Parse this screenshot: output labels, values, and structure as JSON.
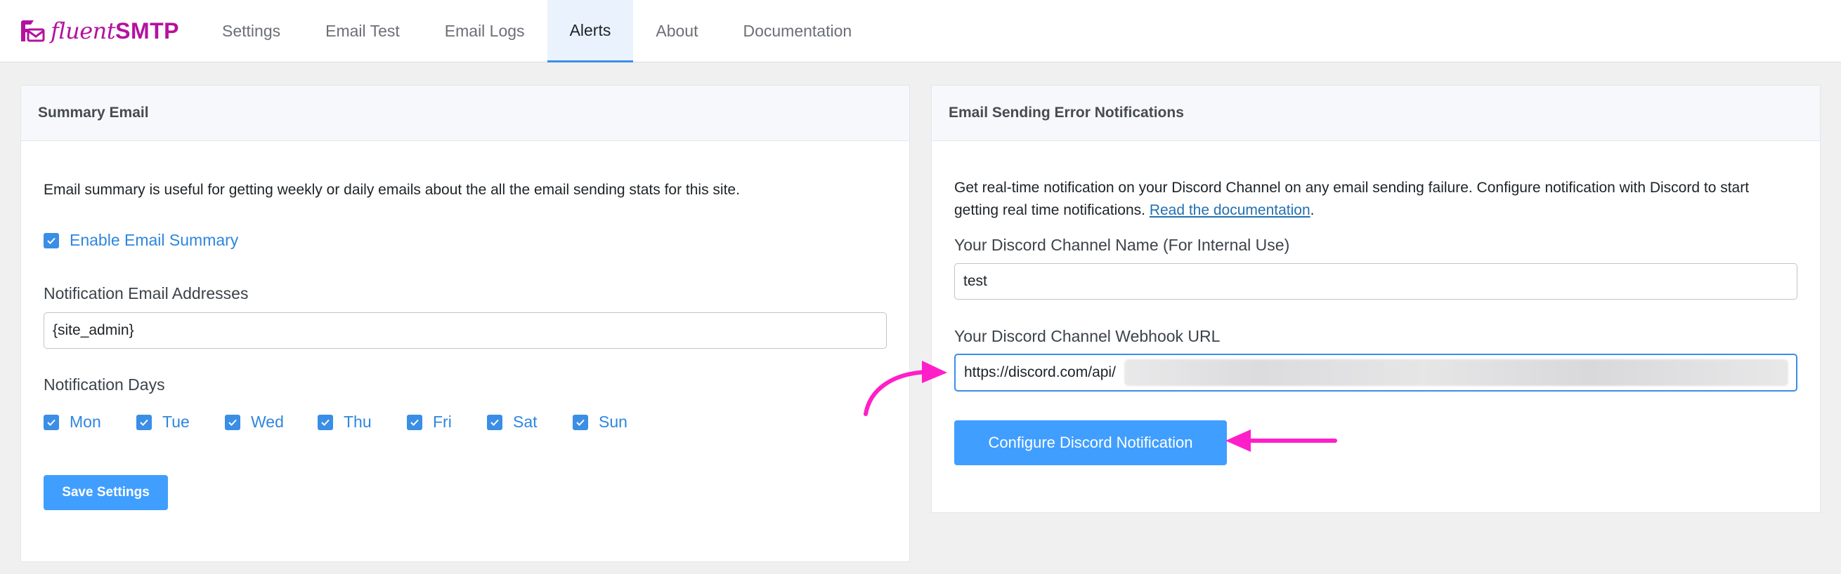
{
  "brand": {
    "name_light": "fluent",
    "name_bold": "SMTP",
    "color": "#b4129f"
  },
  "nav": {
    "items": [
      {
        "label": "Settings"
      },
      {
        "label": "Email Test"
      },
      {
        "label": "Email Logs"
      },
      {
        "label": "Alerts",
        "active": true
      },
      {
        "label": "About"
      },
      {
        "label": "Documentation"
      }
    ]
  },
  "summary": {
    "title": "Summary Email",
    "description": "Email summary is useful for getting weekly or daily emails about the all the email sending stats for this site.",
    "enable_label": "Enable Email Summary",
    "enable_checked": true,
    "emails_label": "Notification Email Addresses",
    "emails_value": "{site_admin}",
    "days_label": "Notification Days",
    "days": [
      {
        "label": "Mon",
        "checked": true
      },
      {
        "label": "Tue",
        "checked": true
      },
      {
        "label": "Wed",
        "checked": true
      },
      {
        "label": "Thu",
        "checked": true
      },
      {
        "label": "Fri",
        "checked": true
      },
      {
        "label": "Sat",
        "checked": true
      },
      {
        "label": "Sun",
        "checked": true
      }
    ],
    "save_label": "Save Settings"
  },
  "errors": {
    "title": "Email Sending Error Notifications",
    "description_line1": "Get real-time notification on your Discord Channel on any email sending failure. Configure notification with Discord to start",
    "description_line2": "getting real time notifications. ",
    "doc_link": "Read the documentation",
    "doc_period": ".",
    "channel_name_label": "Your Discord Channel Name (For Internal Use)",
    "channel_name_value": "test",
    "webhook_label": "Your Discord Channel Webhook URL",
    "webhook_value": "https://discord.com/api/",
    "configure_label": "Configure Discord Notification"
  },
  "colors": {
    "accent": "#409eff",
    "checkbox": "#3a8ee6",
    "annotation_arrow": "#ff1fc8"
  }
}
